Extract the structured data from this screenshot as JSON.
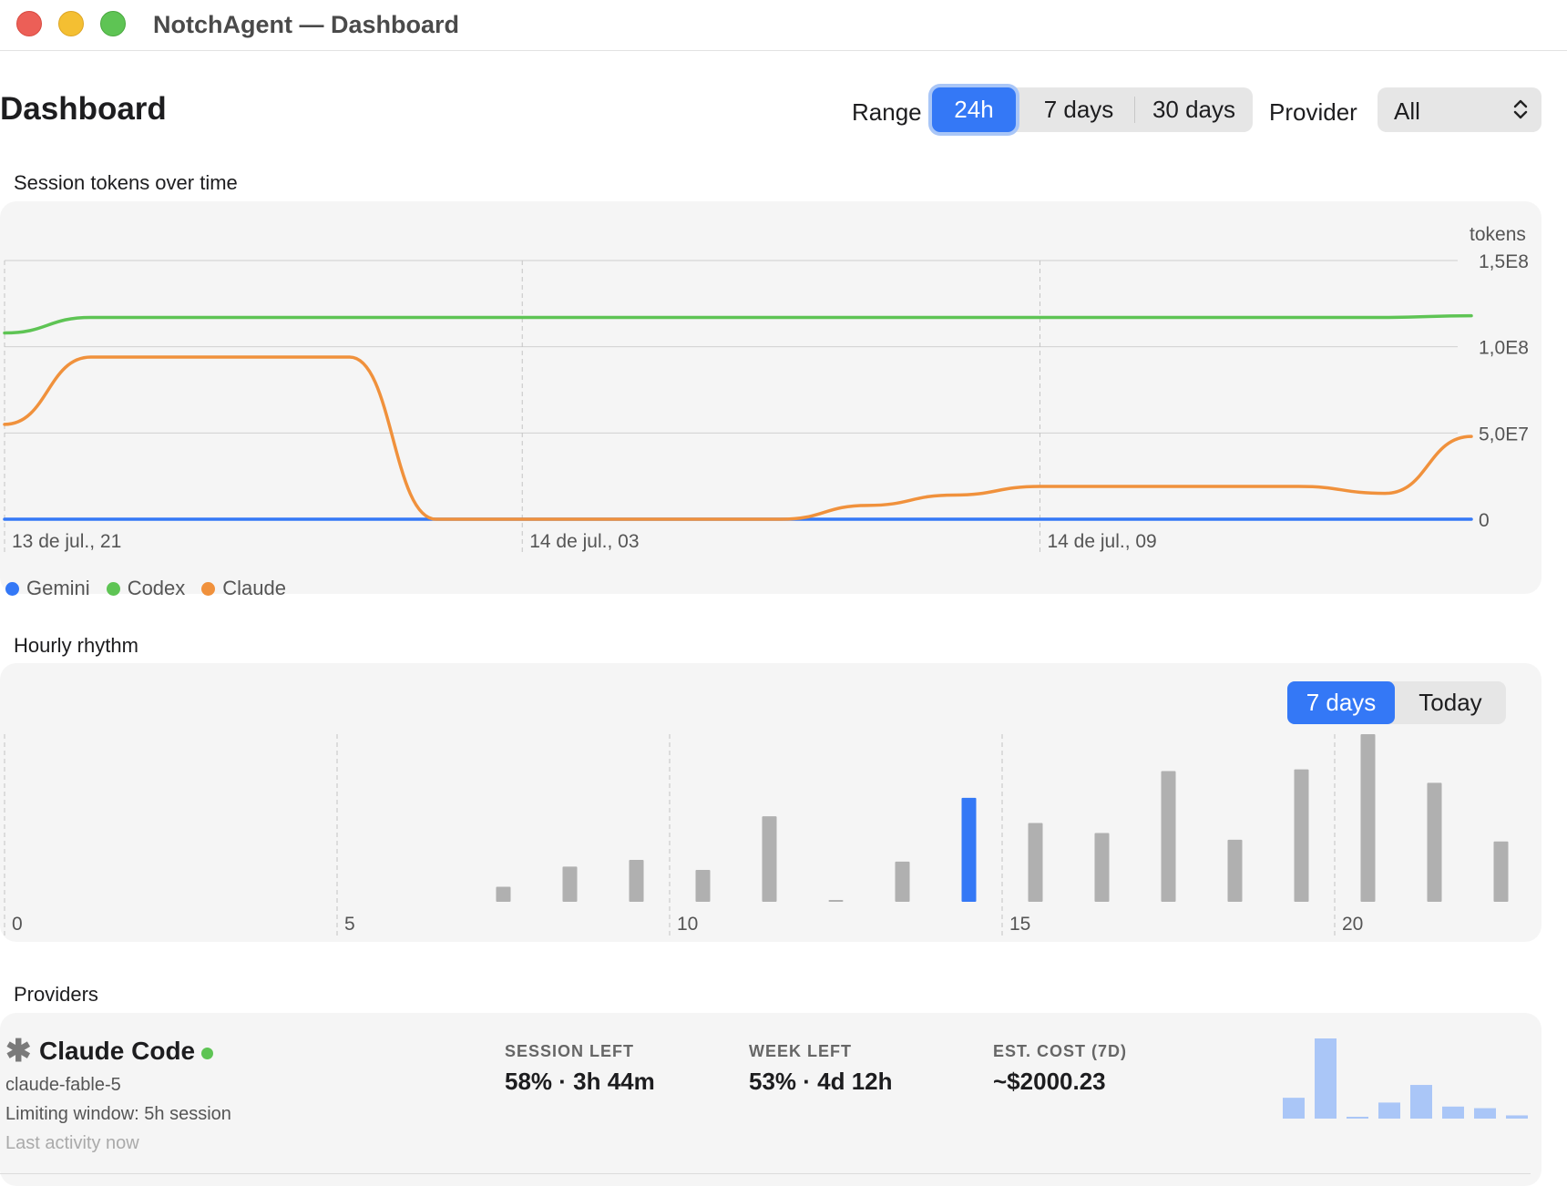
{
  "window": {
    "title": "NotchAgent — Dashboard"
  },
  "header": {
    "page_title": "Dashboard",
    "range_label": "Range",
    "range_options": [
      "24h",
      "7 days",
      "30 days"
    ],
    "range_selected": "24h",
    "provider_label": "Provider",
    "provider_value": "All",
    "provider_select_icon": "chevron-up-down-icon"
  },
  "session_chart": {
    "label": "Session tokens over time",
    "chart_data": {
      "type": "line",
      "ylabel": "tokens",
      "y_ticks": [
        "1,5E8",
        "1,0E8",
        "5,0E7",
        "0"
      ],
      "ylim": [
        0,
        150000000
      ],
      "x_ticks": [
        "13 de jul., 21",
        "14 de jul., 03",
        "14 de jul., 09"
      ],
      "x_hours": [
        0,
        1,
        2,
        3,
        4,
        5,
        6,
        7,
        8,
        9,
        10,
        11,
        12,
        13,
        14,
        15,
        16,
        17
      ],
      "series": [
        {
          "name": "Gemini",
          "color": "#3478f6",
          "values": [
            0,
            0,
            0,
            0,
            0,
            0,
            0,
            0,
            0,
            0,
            0,
            0,
            0,
            0,
            0,
            0,
            0,
            0
          ]
        },
        {
          "name": "Codex",
          "color": "#5ec454",
          "values": [
            108000000,
            117000000,
            117000000,
            117000000,
            117000000,
            117000000,
            117000000,
            117000000,
            117000000,
            117000000,
            117000000,
            117000000,
            117000000,
            117000000,
            117000000,
            117000000,
            117000000,
            118000000
          ]
        },
        {
          "name": "Claude",
          "color": "#f0913c",
          "values": [
            55000000,
            94000000,
            94000000,
            94000000,
            94000000,
            0,
            0,
            0,
            0,
            0,
            8000000,
            14000000,
            19000000,
            19000000,
            19000000,
            19000000,
            15000000,
            48000000
          ]
        }
      ],
      "grid": true,
      "legend_position": "bottom-left"
    }
  },
  "hourly_chart": {
    "label": "Hourly rhythm",
    "toggle_options": [
      "7 days",
      "Today"
    ],
    "toggle_selected": "7 days",
    "chart_data": {
      "type": "bar",
      "x_ticks": [
        "0",
        "5",
        "10",
        "15",
        "20"
      ],
      "categories": [
        0,
        1,
        2,
        3,
        4,
        5,
        6,
        7,
        8,
        9,
        10,
        11,
        12,
        13,
        14,
        15,
        16,
        17,
        18,
        19,
        20,
        21,
        22,
        23
      ],
      "values": [
        0,
        0,
        0,
        0,
        0,
        0,
        0,
        9,
        21,
        25,
        19,
        51,
        1,
        24,
        62,
        47,
        41,
        78,
        37,
        79,
        100,
        71,
        36,
        4
      ],
      "highlight_index": 14,
      "bar_color": "#b0b0b0",
      "highlight_color": "#3478f6",
      "grid": true
    }
  },
  "providers": {
    "label": "Providers",
    "items": [
      {
        "icon": "asterisk-icon",
        "name": "Claude Code",
        "status_color": "#5ec454",
        "model": "claude-fable-5",
        "limiting_window": "Limiting window: 5h session",
        "last_activity": "Last activity now",
        "stats": [
          {
            "label": "SESSION LEFT",
            "value": "58% · 3h 44m"
          },
          {
            "label": "WEEK LEFT",
            "value": "53% · 4d 12h"
          },
          {
            "label": "EST. COST (7D)",
            "value": "~$2000.23"
          }
        ],
        "sparkline": {
          "type": "bar",
          "values": [
            26,
            100,
            2,
            20,
            42,
            15,
            13,
            4
          ],
          "color": "#aac6f7"
        }
      }
    ]
  }
}
